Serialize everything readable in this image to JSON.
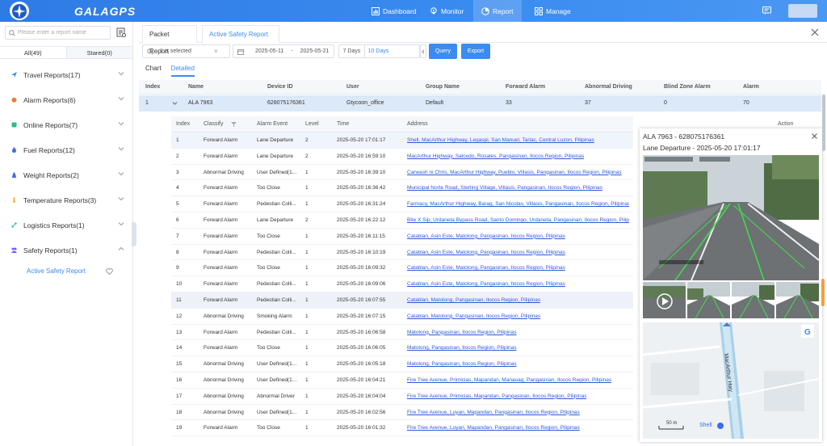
{
  "app": {
    "brand": "GALAGPS"
  },
  "nav": [
    {
      "label": "Dashboard"
    },
    {
      "label": "Monitor"
    },
    {
      "label": "Report"
    },
    {
      "label": "Manage"
    }
  ],
  "sidebar": {
    "search_placeholder": "Please enter a report name",
    "tabs": [
      {
        "label": "All(49)"
      },
      {
        "label": "Stared(0)"
      }
    ],
    "items": [
      {
        "label": "Travel Reports(17)",
        "color": "#3a8cf0"
      },
      {
        "label": "Alarm Reports(6)",
        "color": "#f07a3a"
      },
      {
        "label": "Online Reports(7)",
        "color": "#2bbf8a"
      },
      {
        "label": "Fuel Reports(12)",
        "color": "#3a6cf0"
      },
      {
        "label": "Weight Reports(2)",
        "color": "#3a6cf0"
      },
      {
        "label": "Temperature Reports(3)",
        "color": "#f0b83a"
      },
      {
        "label": "Logistics Reports(1)",
        "color": "#2bbf8a"
      },
      {
        "label": "Safety Reports(1)",
        "color": "#6a5cf0"
      }
    ],
    "active_sub": "Active Safety Report"
  },
  "tabs": [
    {
      "label": "Packet Report"
    },
    {
      "label": "Active Safety Report"
    }
  ],
  "filters": {
    "selected": "1 is selected",
    "date_from": "2025-05-11",
    "date_sep": "-",
    "date_to": "2025-05-21",
    "days7": "7 Days",
    "days10": "10 Days",
    "query": "Query",
    "export": "Export"
  },
  "view_tabs": [
    {
      "label": "Chart"
    },
    {
      "label": "Detailed"
    }
  ],
  "main_table": {
    "headers": [
      "Index",
      "Name",
      "Device ID",
      "User",
      "Group Name",
      "Forward Alarm",
      "Abnormal Driving",
      "Blind Zone Alarm",
      "Alarm"
    ],
    "row": [
      "1",
      "ALA 7963",
      "628075176361",
      "Gtycoon_office",
      "Default",
      "33",
      "37",
      "0",
      "70"
    ]
  },
  "detail_table": {
    "headers": [
      "Index",
      "Classify",
      "Alarm Event",
      "Level",
      "Time",
      "Address",
      "Action"
    ],
    "rows": [
      [
        "1",
        "Forward Alarm",
        "Lane Departure",
        "2",
        "2025-05-20 17:01:17",
        "Shell, MacArthur Highway, Legaspi, San Manuel, Tarlac, Central Luzon, Pilipinas"
      ],
      [
        "2",
        "Forward Alarm",
        "Lane Departure",
        "2",
        "2025-05-20 16:59:10",
        "MacArthur Highway, Salcedo, Rosales, Pangasinan, Ilocos Region, Pilipinas"
      ],
      [
        "3",
        "Abnormal Driving",
        "User Defined(1...",
        "1",
        "2025-05-20 16:39:10",
        "Carwash ni Chris, MacArthur Highway, Pueblo, Villasis, Pangasinan, Ilocos Region, Pilipinas"
      ],
      [
        "4",
        "Forward Alarm",
        "Too Close",
        "1",
        "2025-05-20 16:36:42",
        "Municipal Norte Road, Sterling Village, Villasis, Pangasinan, Ilocos Region, Pilipinas"
      ],
      [
        "5",
        "Forward Alarm",
        "Pedestian Colli...",
        "1",
        "2025-05-20 16:31:24",
        "Farmacy, MacArthur Highway, Barag, San Nicolas, Villasis, Pangasinan, Ilocos Region, Pilipinas"
      ],
      [
        "6",
        "Forward Alarm",
        "Lane Departure",
        "2",
        "2025-05-20 16:22:12",
        "Bite X Sip, Urdaneta Bypass Road, Santo Domingo, Urdaneta, Pangasinan, Ilocos Region, Pilipinas"
      ],
      [
        "7",
        "Forward Alarm",
        "Too Close",
        "1",
        "2025-05-20 16:11:15",
        "Catablan, Asin Este, Matolong, Pangasinan, Ilocos Region, Pilipinas"
      ],
      [
        "8",
        "Forward Alarm",
        "Pedestian Colli...",
        "1",
        "2025-05-20 16:10:19",
        "Catablan, Asin Este, Matolong, Pangasinan, Ilocos Region, Pilipinas"
      ],
      [
        "9",
        "Forward Alarm",
        "Too Close",
        "1",
        "2025-05-20 16:09:32",
        "Catablan, Asin Este, Matolong, Pangasinan, Ilocos Region, Pilipinas"
      ],
      [
        "10",
        "Forward Alarm",
        "Pedestian Colli...",
        "1",
        "2025-05-20 16:09:06",
        "Catablan, Asin Este, Matolong, Pangasinan, Ilocos Region, Pilipinas"
      ],
      [
        "11",
        "Forward Alarm",
        "Pedestian Colli...",
        "1",
        "2025-05-20 16:07:55",
        "Catablan, Matolong, Pangasinan, Ilocos Region, Pilipinas"
      ],
      [
        "12",
        "Abnormal Driving",
        "Smoking Alarm",
        "1",
        "2025-05-20 16:07:15",
        "Catablan, Matolong, Pangasinan, Ilocos Region, Pilipinas"
      ],
      [
        "13",
        "Forward Alarm",
        "Pedestian Colli...",
        "1",
        "2025-05-20 16:06:58",
        "Matolong, Pangasinan, Ilocos Region, Pilipinas"
      ],
      [
        "14",
        "Forward Alarm",
        "Too Close",
        "1",
        "2025-05-20 16:06:05",
        "Matolong, Pangasinan, Ilocos Region, Pilipinas"
      ],
      [
        "15",
        "Abnormal Driving",
        "User Defined(1...",
        "1",
        "2025-05-20 16:05:18",
        "Matolong, Pangasinan, Ilocos Region, Pilipinas"
      ],
      [
        "16",
        "Abnormal Driving",
        "User Defined(1...",
        "1",
        "2025-05-20 16:04:21",
        "Fire Tree Avenue, Primicias, Mapandan, Manaoag, Pangasinan, Ilocos Region, Pilipinas"
      ],
      [
        "17",
        "Abnormal Driving",
        "Abnormal Driver",
        "1",
        "2025-05-20 16:04:04",
        "Fire Tree Avenue, Primicias, Mapandan, Pangasinan, Ilocos Region, Pilipinas"
      ],
      [
        "18",
        "Abnormal Driving",
        "User Defined(1...",
        "1",
        "2025-05-20 16:02:56",
        "Fire Tree Avenue, Luyan, Mapandan, Pangasinan, Ilocos Region, Pilipinas"
      ],
      [
        "19",
        "Forward Alarm",
        "Too Close",
        "1",
        "2025-05-20 16:01:32",
        "Fire Tree Avenue, Luyan, Mapandan, Pangasinan, Ilocos Region, Pilipinas"
      ]
    ]
  },
  "popup": {
    "title": "ALA 7963 - 628075176361",
    "event": "Lane Departure - 2025-05-20 17:01:17",
    "map_road": "MacArthur Hwy",
    "map_scale": "50 m",
    "map_poi": "Shell"
  }
}
